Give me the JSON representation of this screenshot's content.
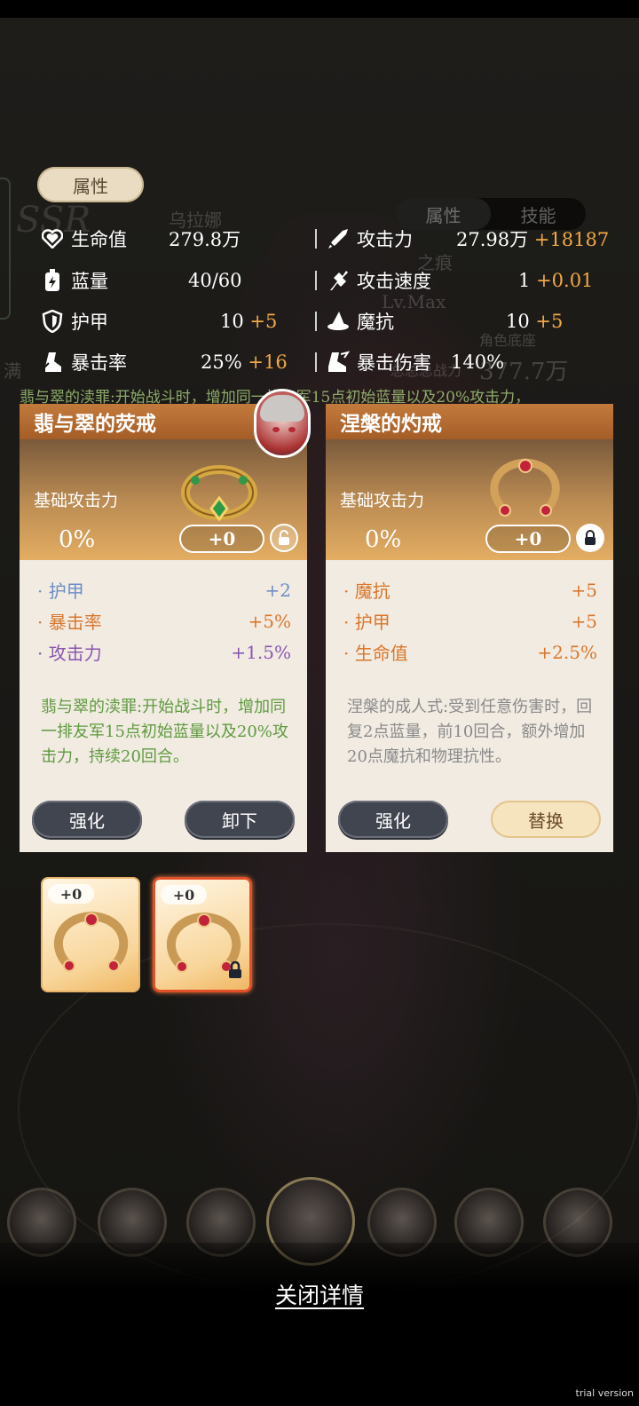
{
  "attributes": {
    "tab_label": "属性",
    "right_tabs": [
      "属性",
      "技能"
    ],
    "bg_labels": {
      "name": "乌拉娜",
      "title": "之痕",
      "level": "Lv.Max",
      "power_label": "总总总战力",
      "power_value": "377.7万",
      "rank": "角色底座",
      "side_name": "满"
    },
    "left_stats": [
      {
        "icon": "heart-icon",
        "name": "生命值",
        "value": "279.8万",
        "bonus": ""
      },
      {
        "icon": "mana-bottle-icon",
        "name": "蓝量",
        "value": "40/60",
        "bonus": ""
      },
      {
        "icon": "shield-icon",
        "name": "护甲",
        "value": "10",
        "bonus": "+5"
      },
      {
        "icon": "crit-boot-icon",
        "name": "暴击率",
        "value": "25%",
        "bonus": "+16"
      }
    ],
    "right_stats": [
      {
        "icon": "sword-icon",
        "name": "攻击力",
        "value": "27.98万",
        "bonus": "+18187"
      },
      {
        "icon": "attack-speed-icon",
        "name": "攻击速度",
        "value": "1",
        "bonus": "+0.01"
      },
      {
        "icon": "wizard-hat-icon",
        "name": "魔抗",
        "value": "10",
        "bonus": "+5"
      },
      {
        "icon": "crit-damage-icon",
        "name": "暴击伤害",
        "value": "140%",
        "bonus": ""
      }
    ],
    "hint": "翡与翠的渎罪:开始战斗时，增加同一排友军15点初始蓝量以及20%攻击力，"
  },
  "cards": [
    {
      "title": "翡与翠的荧戒",
      "base_label": "基础攻击力",
      "base_value": "0%",
      "level": "+0",
      "locked": false,
      "substats": [
        {
          "name": "护甲",
          "value": "+2",
          "color": "#6d8ec6"
        },
        {
          "name": "暴击率",
          "value": "+5%",
          "color": "#d9772c"
        },
        {
          "name": "攻击力",
          "value": "+1.5%",
          "color": "#8a56b0"
        }
      ],
      "description": "翡与翠的渎罪:开始战斗时，增加同一排友军15点初始蓝量以及20%攻击力，持续20回合。",
      "desc_color": "#5f9a3f",
      "buttons": [
        "强化",
        "卸下"
      ]
    },
    {
      "title": "涅槃的灼戒",
      "base_label": "基础攻击力",
      "base_value": "0%",
      "level": "+0",
      "locked": true,
      "substats": [
        {
          "name": "魔抗",
          "value": "+5",
          "color": "#d9772c"
        },
        {
          "name": "护甲",
          "value": "+5",
          "color": "#d9772c"
        },
        {
          "name": "生命值",
          "value": "+2.5%",
          "color": "#d9772c"
        }
      ],
      "description": "涅槃的成人式:受到任意伤害时，回复2点蓝量，前10回合，额外增加20点魔抗和物理抗性。",
      "desc_color": "#8a8a8a",
      "buttons": [
        "强化",
        "替换"
      ]
    }
  ],
  "inventory": [
    {
      "level": "+0",
      "selected": false,
      "locked": false
    },
    {
      "level": "+0",
      "selected": true,
      "locked": true
    }
  ],
  "footer": {
    "close_label": "关闭详情",
    "watermark": "trial version"
  },
  "colors": {
    "bonus": "#f2a943",
    "card_header": "#b46a30",
    "panel": "#f1ebe2"
  }
}
